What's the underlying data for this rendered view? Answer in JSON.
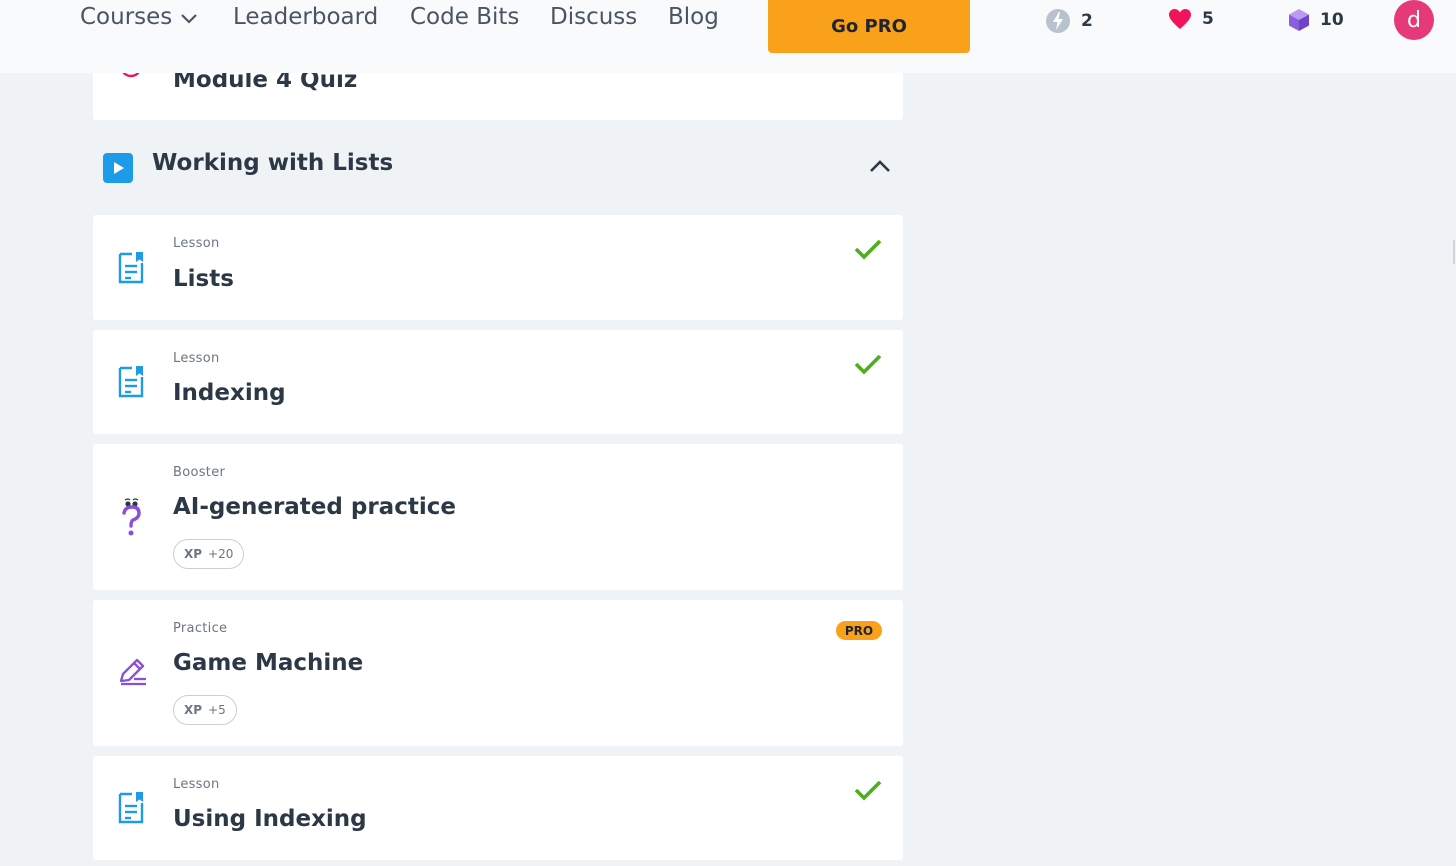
{
  "nav": {
    "items": [
      {
        "label": "Courses"
      },
      {
        "label": "Leaderboard"
      },
      {
        "label": "Code Bits"
      },
      {
        "label": "Discuss"
      },
      {
        "label": "Blog"
      }
    ],
    "go_pro_label": "Go PRO",
    "stats": {
      "streak": "2",
      "hearts": "5",
      "gems": "10"
    },
    "avatar_initial": "d"
  },
  "previous_item": {
    "title": "Module 4 Quiz",
    "icon": "target-icon"
  },
  "section": {
    "title": "Working with Lists",
    "icon": "play-icon",
    "expanded": true
  },
  "items": [
    {
      "type": "Lesson",
      "title": "Lists",
      "icon": "lesson-doc-icon",
      "completed": true
    },
    {
      "type": "Lesson",
      "title": "Indexing",
      "icon": "lesson-doc-icon",
      "completed": true
    },
    {
      "type": "Booster",
      "title": "AI-generated practice",
      "icon": "question-mark-icon",
      "xp_label": "XP",
      "xp_value": "+20"
    },
    {
      "type": "Practice",
      "title": "Game Machine",
      "icon": "pencil-icon",
      "badge": "PRO",
      "xp_label": "XP",
      "xp_value": "+5"
    },
    {
      "type": "Lesson",
      "title": "Using Indexing",
      "icon": "lesson-doc-icon",
      "completed": true
    }
  ],
  "colors": {
    "accent_orange": "#f9a11b",
    "check_green": "#4cb01c",
    "lesson_blue": "#1e9be8",
    "practice_purple": "#8a4fd8",
    "heart_red": "#f0155a",
    "avatar_pink": "#e6397a"
  }
}
